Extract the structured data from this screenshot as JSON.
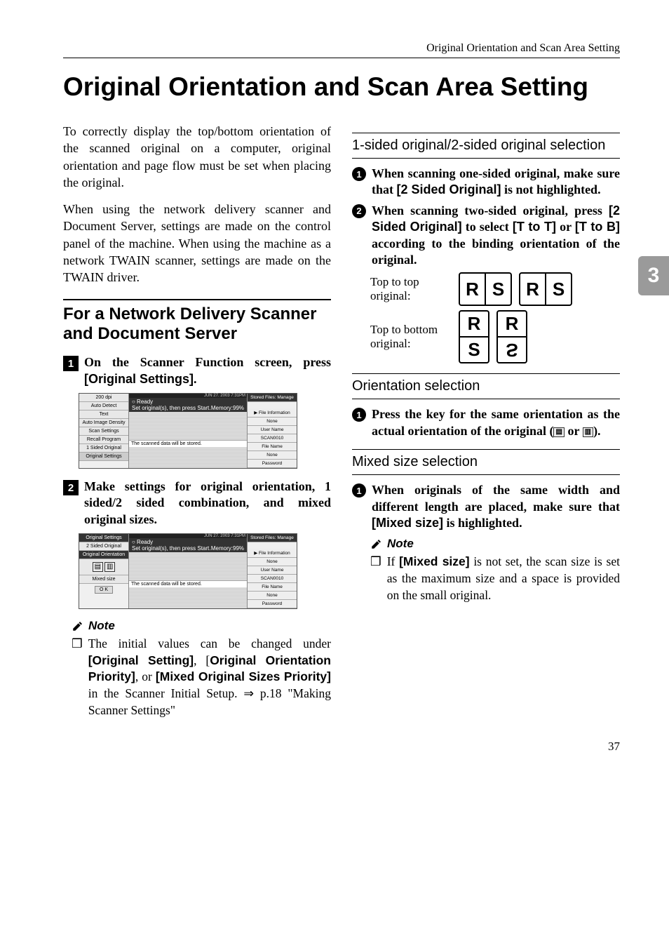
{
  "running_head": "Original Orientation and Scan Area Setting",
  "title": "Original Orientation and Scan Area Setting",
  "side_tab": "3",
  "left": {
    "para1": "To correctly display the top/bottom orientation of the scanned original on a computer, original orientation and page flow must be set when placing the original.",
    "para2": "When using the network delivery scanner and Document Server, settings are made on the control panel of the machine. When using the machine as a network TWAIN scanner, settings are made on the TWAIN driver.",
    "section": "For a Network Delivery Scanner and Document Server",
    "step1_a": "On the Scanner Function screen, press ",
    "step1_b": "[Original Settings]",
    "step1_c": ".",
    "step2": "Make settings for original orientation, 1 sided/2 sided combination, and mixed original sizes.",
    "note_label": "Note",
    "note1_a": "The initial values can be changed under ",
    "note1_b": "[Original Setting]",
    "note1_c": ", [",
    "note1_d": "Original Orientation Priority]",
    "note1_e": ", or ",
    "note1_f": "[Mixed Original Sizes Priority]",
    "note1_g": " in the Scanner Initial Setup. ⇒ p.18 \"Making Scanner Settings\""
  },
  "right": {
    "sub1": "1-sided original/2-sided original selection",
    "c1_a": "When scanning one-sided original, make sure that ",
    "c1_b": "[2 Sided Original]",
    "c1_c": " is not highlighted.",
    "c2_a": "When scanning two-sided original, press ",
    "c2_b": "[2 Sided Original]",
    "c2_c": " to select ",
    "c2_d": "[T to T]",
    "c2_e": " or ",
    "c2_f": "[T to B]",
    "c2_g": " according to the binding orientation of the original.",
    "orient1_label": "Top to top original:",
    "orient2_label": "Top to bottom original:",
    "R": "R",
    "S": "S",
    "sub2": "Orientation selection",
    "c3_a": "Press the key for the same orientation as the actual orientation of the original (",
    "c3_b": " or ",
    "c3_c": ").",
    "sub3": "Mixed size selection",
    "c4_a": "When originals of the same width and different length are placed, make sure that ",
    "c4_b": "[Mixed size]",
    "c4_c": " is highlighted.",
    "note_label": "Note",
    "note2_a": "If ",
    "note2_b": "[Mixed size]",
    "note2_c": " is not set, the scan size is set as the maximum size and a space is provided on the small original."
  },
  "screenshot1": {
    "topbar": "JUN   27. 2003   7:31PM",
    "left": [
      "200 dpi",
      "Auto Detect",
      "Text",
      "Auto Image Density",
      "Scan Settings",
      "Recall Program",
      "1 Sided Original",
      "Original Settings"
    ],
    "ready": "○ Ready",
    "instr": "Set original(s), then press Start.",
    "memory": "Memory:99%",
    "scanned": "The scanned data will be stored.",
    "right_top": "Stored Files: Manage",
    "right": [
      "▶ File Information",
      "None",
      "User Name",
      "SCAN0010",
      "File Name",
      "None",
      "Password"
    ]
  },
  "screenshot2": {
    "topbar": "JUN   27. 2003   7:31PM",
    "left": [
      "Original Settings",
      "2 Sided Original",
      "Original Orientation",
      "",
      "Mixed size",
      "O K"
    ],
    "ready": "○ Ready",
    "instr": "Set original(s), then press Start.",
    "memory": "Memory:99%",
    "scanned": "The scanned data will be stored.",
    "right_top": "Stored Files: Manage",
    "right": [
      "▶ File Information",
      "None",
      "User Name",
      "SCAN0010",
      "File Name",
      "None",
      "Password"
    ]
  },
  "page_num": "37"
}
